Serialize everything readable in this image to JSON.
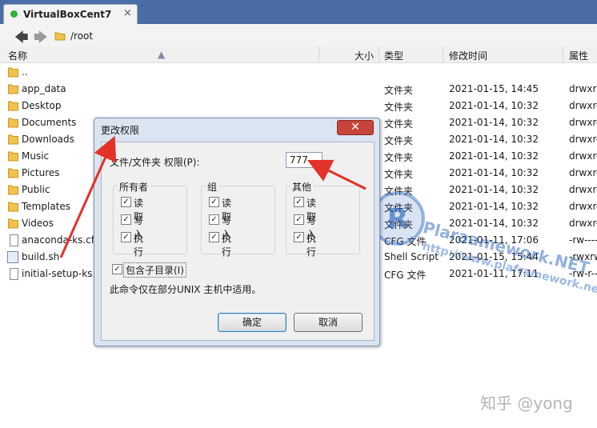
{
  "tab": {
    "title": "VirtualBoxCent7",
    "close": "×"
  },
  "address": {
    "back": "🡄",
    "forward": "🡆",
    "path": "/root"
  },
  "columns": {
    "name": "名称",
    "size": "大小",
    "type": "类型",
    "modified": "修改时间",
    "attributes": "属性"
  },
  "files": [
    {
      "name": "..",
      "kind": "folder",
      "type": "",
      "date": "",
      "attr": ""
    },
    {
      "name": "app_data",
      "kind": "folder",
      "type": "文件夹",
      "date": "2021-01-15, 14:45",
      "attr": "drwxrw"
    },
    {
      "name": "Desktop",
      "kind": "folder",
      "type": "文件夹",
      "date": "2021-01-14, 10:32",
      "attr": "drwxr-"
    },
    {
      "name": "Documents",
      "kind": "folder",
      "type": "文件夹",
      "date": "2021-01-14, 10:32",
      "attr": "drwxr-"
    },
    {
      "name": "Downloads",
      "kind": "folder",
      "type": "文件夹",
      "date": "2021-01-14, 10:32",
      "attr": "drwxr-"
    },
    {
      "name": "Music",
      "kind": "folder",
      "type": "文件夹",
      "date": "2021-01-14, 10:32",
      "attr": "drwxr-"
    },
    {
      "name": "Pictures",
      "kind": "folder",
      "type": "文件夹",
      "date": "2021-01-14, 10:32",
      "attr": "drwxr-"
    },
    {
      "name": "Public",
      "kind": "folder",
      "type": "文件夹",
      "date": "2021-01-14, 10:32",
      "attr": "drwxr-"
    },
    {
      "name": "Templates",
      "kind": "folder",
      "type": "文件夹",
      "date": "2021-01-14, 10:32",
      "attr": "drwxr-"
    },
    {
      "name": "Videos",
      "kind": "folder",
      "type": "文件夹",
      "date": "2021-01-14, 10:32",
      "attr": "drwxr-"
    },
    {
      "name": "anaconda-ks.cfg",
      "kind": "file",
      "type": "CFG 文件",
      "date": "2021-01-11, 17:06",
      "attr": "-rw----"
    },
    {
      "name": "build.sh",
      "kind": "script",
      "type": "Shell Script",
      "date": "2021-01-15, 15:44",
      "attr": "-rwxrw"
    },
    {
      "name": "initial-setup-ks.cfg",
      "kind": "file",
      "type": "CFG 文件",
      "date": "2021-01-11, 17:11",
      "attr": "-rw-r--"
    }
  ],
  "dialog": {
    "title": "更改权限",
    "close": "✕",
    "perm_label": "文件/文件夹 权限(P):",
    "perm_value": "777",
    "groups": [
      {
        "title": "所有者",
        "items": [
          "读取",
          "写入",
          "执行"
        ]
      },
      {
        "title": "组",
        "items": [
          "读取",
          "写入",
          "执行"
        ]
      },
      {
        "title": "其他",
        "items": [
          "读取",
          "写入",
          "执行"
        ]
      }
    ],
    "checkmark": "✓",
    "recursive_label": "包含子目录(I)",
    "note": "此命令仅在部分UNIX 主机中适用。",
    "ok": "确定",
    "cancel": "取消"
  },
  "watermark": {
    "site1": "Plaraamework.NET",
    "site2": "http://www.plaframework.net",
    "credit": "知乎 @yong"
  },
  "colors": {
    "topbar": "#4a6da5",
    "folder": "#f2c14e",
    "arrow": "#e3322a",
    "close_button": "#c6443a"
  }
}
